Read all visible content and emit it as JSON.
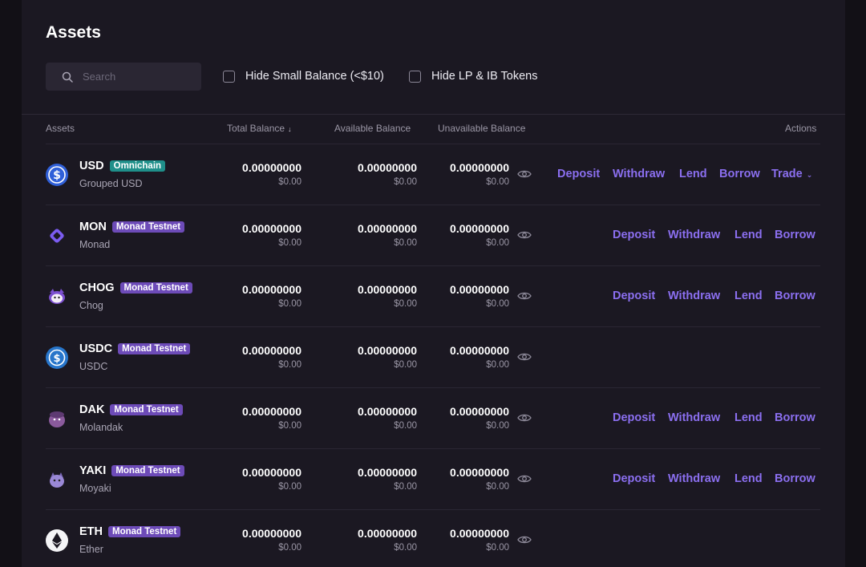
{
  "page": {
    "title": "Assets"
  },
  "search": {
    "placeholder": "Search"
  },
  "filters": {
    "hide_small": "Hide Small Balance (<$10)",
    "hide_lp": "Hide LP & IB Tokens"
  },
  "table": {
    "headers": {
      "assets": "Assets",
      "total": "Total Balance",
      "total_sort": "↓",
      "available": "Available Balance",
      "unavailable": "Unavailable Balance",
      "actions": "Actions"
    },
    "rows": [
      {
        "symbol": "USD",
        "badge": "Omnichain",
        "name": "Grouped USD",
        "icon": "usd-coin-icon",
        "total": "0.00000000",
        "total_usd": "$0.00",
        "available": "0.00000000",
        "available_usd": "$0.00",
        "unavailable": "0.00000000",
        "unavailable_usd": "$0.00",
        "actions": [
          "Deposit",
          "Withdraw",
          "Lend",
          "Borrow",
          "Trade"
        ]
      },
      {
        "symbol": "MON",
        "badge": "Monad Testnet",
        "name": "Monad",
        "icon": "monad-icon",
        "total": "0.00000000",
        "total_usd": "$0.00",
        "available": "0.00000000",
        "available_usd": "$0.00",
        "unavailable": "0.00000000",
        "unavailable_usd": "$0.00",
        "actions": [
          "Deposit",
          "Withdraw",
          "Lend",
          "Borrow"
        ]
      },
      {
        "symbol": "CHOG",
        "badge": "Monad Testnet",
        "name": "Chog",
        "icon": "chog-icon",
        "total": "0.00000000",
        "total_usd": "$0.00",
        "available": "0.00000000",
        "available_usd": "$0.00",
        "unavailable": "0.00000000",
        "unavailable_usd": "$0.00",
        "actions": [
          "Deposit",
          "Withdraw",
          "Lend",
          "Borrow"
        ]
      },
      {
        "symbol": "USDC",
        "badge": "Monad Testnet",
        "name": "USDC",
        "icon": "usdc-icon",
        "total": "0.00000000",
        "total_usd": "$0.00",
        "available": "0.00000000",
        "available_usd": "$0.00",
        "unavailable": "0.00000000",
        "unavailable_usd": "$0.00",
        "actions": []
      },
      {
        "symbol": "DAK",
        "badge": "Monad Testnet",
        "name": "Molandak",
        "icon": "molandak-icon",
        "total": "0.00000000",
        "total_usd": "$0.00",
        "available": "0.00000000",
        "available_usd": "$0.00",
        "unavailable": "0.00000000",
        "unavailable_usd": "$0.00",
        "actions": [
          "Deposit",
          "Withdraw",
          "Lend",
          "Borrow"
        ]
      },
      {
        "symbol": "YAKI",
        "badge": "Monad Testnet",
        "name": "Moyaki",
        "icon": "moyaki-icon",
        "total": "0.00000000",
        "total_usd": "$0.00",
        "available": "0.00000000",
        "available_usd": "$0.00",
        "unavailable": "0.00000000",
        "unavailable_usd": "$0.00",
        "actions": [
          "Deposit",
          "Withdraw",
          "Lend",
          "Borrow"
        ]
      },
      {
        "symbol": "ETH",
        "badge": "Monad Testnet",
        "name": "Ether",
        "icon": "ethereum-icon",
        "total": "0.00000000",
        "total_usd": "$0.00",
        "available": "0.00000000",
        "available_usd": "$0.00",
        "unavailable": "0.00000000",
        "unavailable_usd": "$0.00",
        "actions": []
      }
    ]
  },
  "colors": {
    "accent": "#8b6ff0",
    "badge": "#6d4bb8",
    "omnichain_badge": "#1f8f8a",
    "panel": "#1b1822"
  }
}
